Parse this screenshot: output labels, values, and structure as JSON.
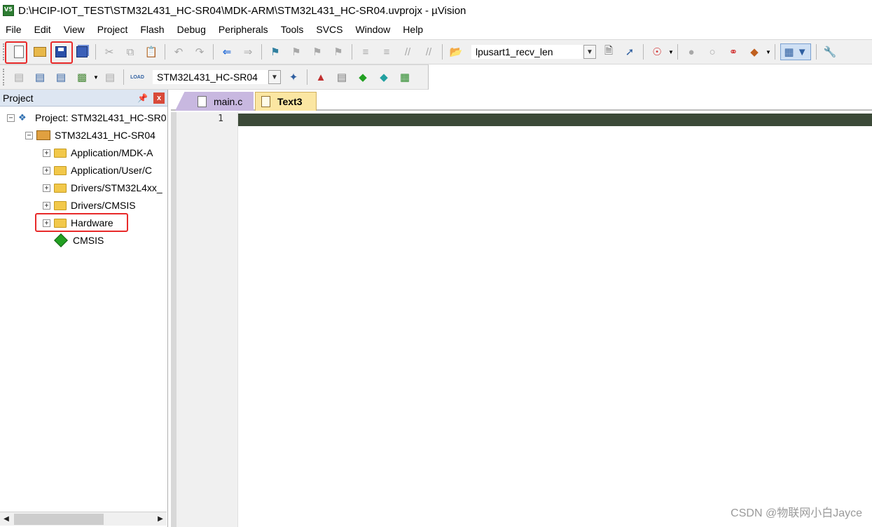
{
  "window": {
    "title": "D:\\HCIP-IOT_TEST\\STM32L431_HC-SR04\\MDK-ARM\\STM32L431_HC-SR04.uvprojx - µVision"
  },
  "menu": {
    "items": [
      {
        "label": "File"
      },
      {
        "label": "Edit"
      },
      {
        "label": "View"
      },
      {
        "label": "Project"
      },
      {
        "label": "Flash"
      },
      {
        "label": "Debug"
      },
      {
        "label": "Peripherals"
      },
      {
        "label": "Tools"
      },
      {
        "label": "SVCS"
      },
      {
        "label": "Window"
      },
      {
        "label": "Help"
      }
    ]
  },
  "toolbar1": {
    "find_combo_value": "lpusart1_recv_len"
  },
  "toolbar2": {
    "target_combo_value": "STM32L431_HC-SR04",
    "load_label": "LOAD"
  },
  "project_panel": {
    "title": "Project",
    "pin_glyph": "❀",
    "close_glyph": "x",
    "tree": [
      {
        "label": "Project: STM32L431_HC-SR0",
        "level": 0,
        "expander": "−"
      },
      {
        "label": "STM32L431_HC-SR04",
        "level": 1,
        "expander": "−"
      },
      {
        "label": "Application/MDK-A",
        "level": 2,
        "expander": "+"
      },
      {
        "label": "Application/User/C",
        "level": 2,
        "expander": "+"
      },
      {
        "label": "Drivers/STM32L4xx_",
        "level": 2,
        "expander": "+"
      },
      {
        "label": "Drivers/CMSIS",
        "level": 2,
        "expander": "+"
      },
      {
        "label": "Hardware",
        "level": 2,
        "expander": "+"
      },
      {
        "label": "CMSIS",
        "level": 2,
        "expander": ""
      }
    ]
  },
  "editor": {
    "tabs": [
      {
        "label": "main.c",
        "active": false
      },
      {
        "label": "Text3",
        "active": true
      }
    ],
    "line_numbers": [
      "1"
    ]
  },
  "watermark": "CSDN @物联网小白Jayce",
  "colors": {
    "highlight_red": "#e82a2a",
    "panel_header_bg": "#dde6f2",
    "current_line_bg": "#3c4a38",
    "active_tab_bg": "#fbe6a2",
    "inactive_tab_bg": "#c8b8e0"
  }
}
